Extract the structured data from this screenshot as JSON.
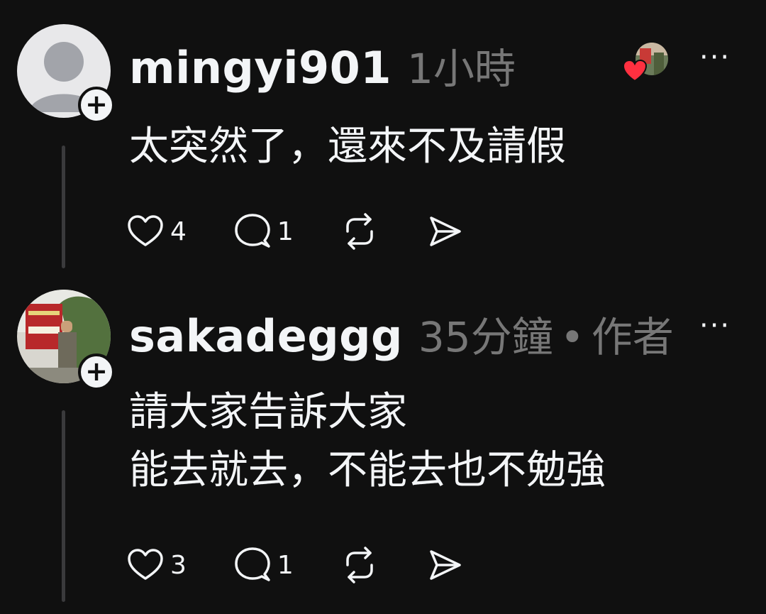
{
  "colors": {
    "background": "#101010",
    "primary_text": "#f3f5f7",
    "secondary_text": "#777777",
    "thread_line": "#3a3a3c",
    "heart_badge": "#ff3040"
  },
  "posts": [
    {
      "username": "mingyi901",
      "time": "1小時",
      "author_label": "",
      "content": "太突然了，還來不及請假",
      "like_count": "4",
      "reply_count": "1",
      "avatar": "default-person-icon",
      "liked_by_author_badge": true
    },
    {
      "username": "sakadeggg",
      "time": "35分鐘",
      "author_label": "作者",
      "content": "請大家告訴大家\n能去就去，不能去也不勉強",
      "like_count": "3",
      "reply_count": "1",
      "avatar": "photo-avatar"
    }
  ],
  "icons": {
    "follow": "plus-icon",
    "more": "more-options-icon",
    "like": "heart-icon",
    "reply": "reply-bubble-icon",
    "repost": "repost-icon",
    "share": "send-icon"
  },
  "labels": {
    "follow_symbol": "+",
    "more_symbol": "···",
    "dot_separator": "•"
  }
}
